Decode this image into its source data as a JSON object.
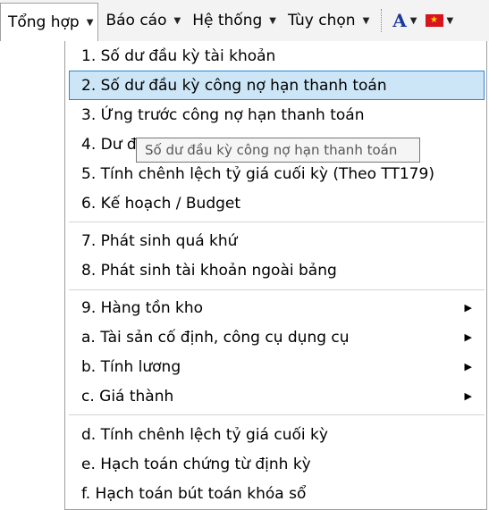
{
  "menubar": {
    "items": [
      {
        "label": "Tổng hợp"
      },
      {
        "label": "Báo cáo"
      },
      {
        "label": "Hệ thống"
      },
      {
        "label": "Tùy chọn"
      }
    ],
    "font_button_glyph": "A",
    "font_icon": "font-color-icon",
    "flag_icon": "vietnam-flag-icon"
  },
  "dropdown": {
    "items": [
      {
        "label": "1. Số dư đầu kỳ tài khoản"
      },
      {
        "label": "2. Số dư đầu kỳ công nợ hạn thanh toán"
      },
      {
        "label": "3. Ứng trước công nợ hạn thanh toán"
      },
      {
        "label": "4. Dư đ"
      },
      {
        "label": "5. Tính chênh lệch tỷ giá cuối kỳ (Theo TT179)"
      },
      {
        "label": "6. Kế hoạch / Budget"
      },
      {
        "label": "7. Phát sinh quá khứ"
      },
      {
        "label": "8. Phát sinh tài khoản ngoài bảng"
      },
      {
        "label": "9. Hàng tồn kho"
      },
      {
        "label": "a. Tài sản cố định, công cụ dụng cụ"
      },
      {
        "label": "b. Tính lương"
      },
      {
        "label": "c. Giá thành"
      },
      {
        "label": "d. Tính chênh lệch tỷ giá cuối kỳ"
      },
      {
        "label": "e. Hạch toán chứng từ định kỳ"
      },
      {
        "label": "f. Hạch toán bút toán khóa sổ"
      }
    ],
    "highlighted_index": 1
  },
  "tooltip": {
    "text": "Số dư đầu kỳ công nợ hạn thanh toán"
  },
  "colors": {
    "highlight_bg": "#cde6f7",
    "highlight_border": "#2f86d4",
    "font_button": "#1a3a9c",
    "flag_red": "#d8141c"
  }
}
